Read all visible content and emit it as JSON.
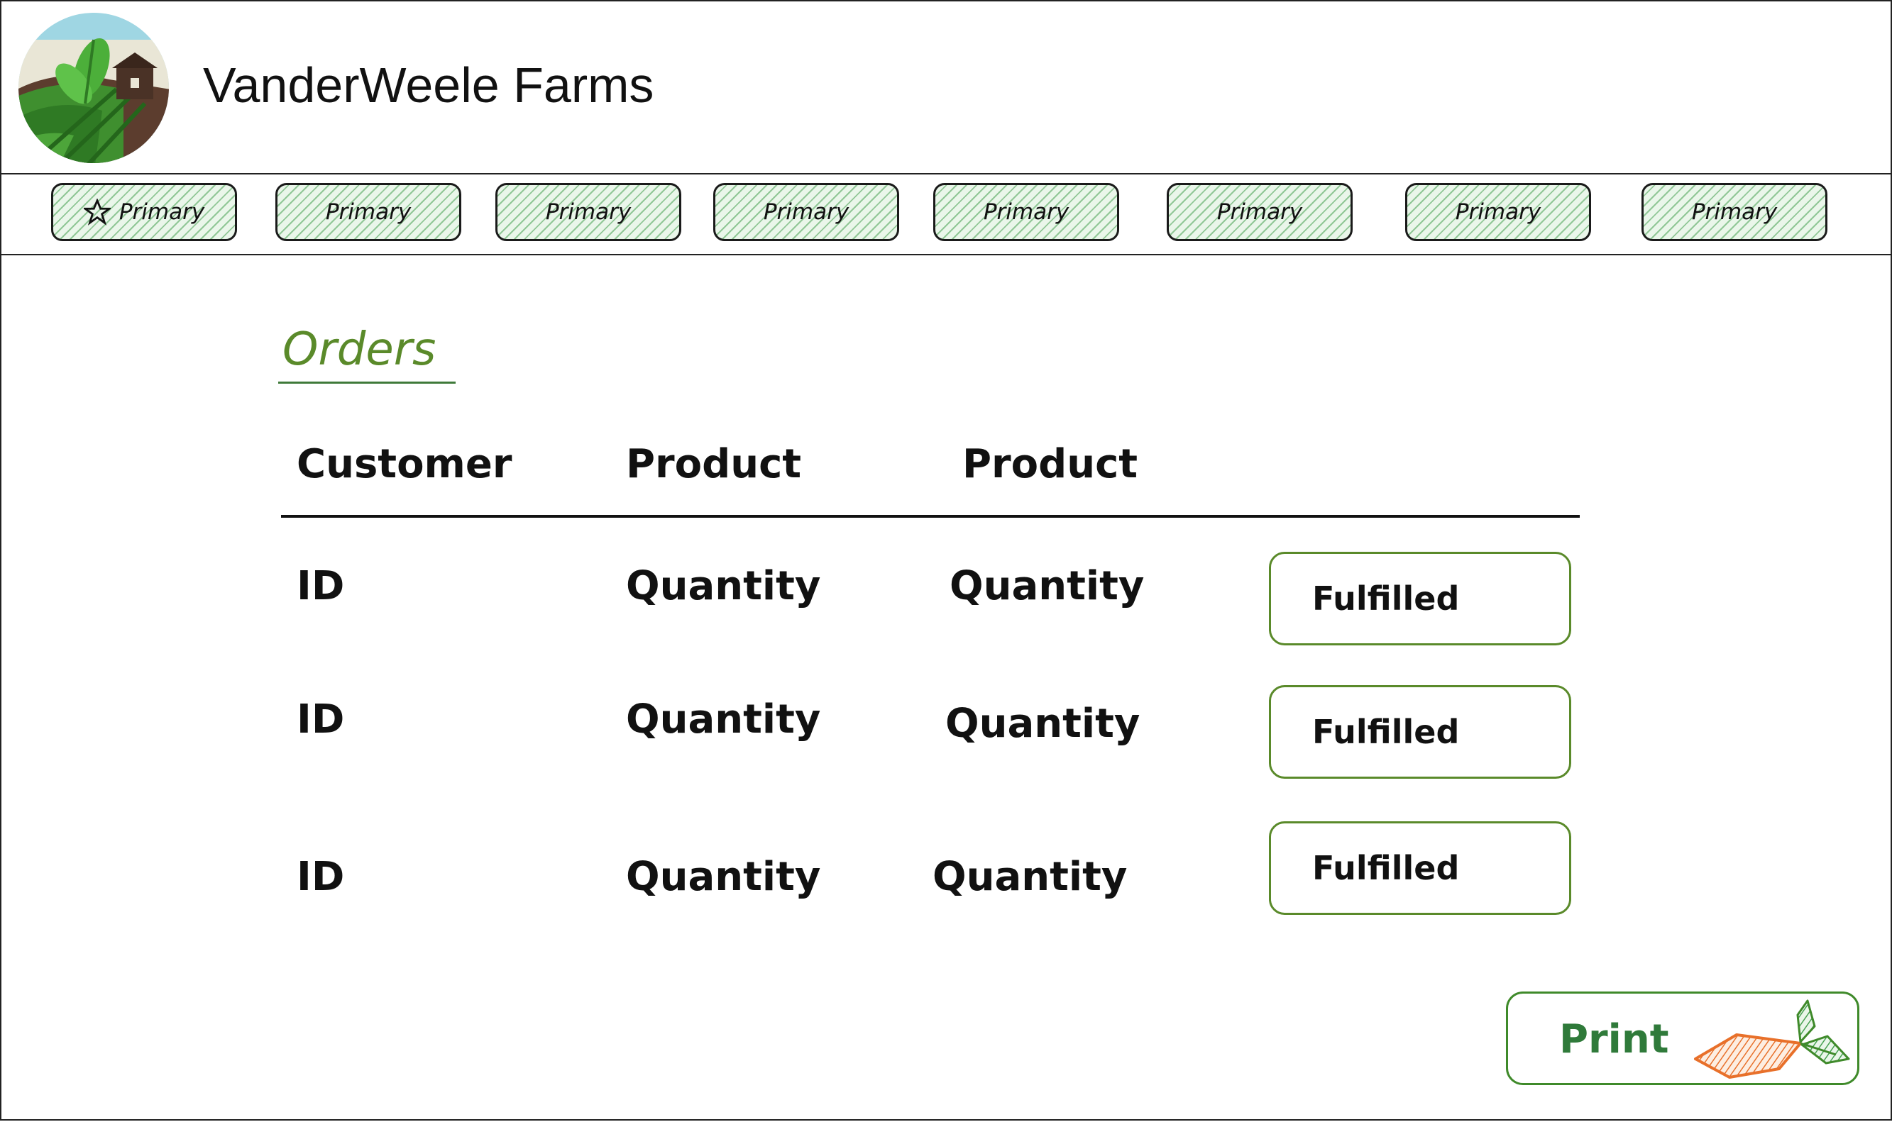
{
  "app": {
    "title": "VanderWeele Farms",
    "logo_icon": "farm-field-icon"
  },
  "nav": {
    "items": [
      {
        "label": "Primary",
        "icon": "star-icon"
      },
      {
        "label": "Primary"
      },
      {
        "label": "Primary"
      },
      {
        "label": "Primary"
      },
      {
        "label": "Primary"
      },
      {
        "label": "Primary"
      },
      {
        "label": "Primary"
      },
      {
        "label": "Primary"
      }
    ]
  },
  "orders": {
    "title": "Orders",
    "columns": [
      "Customer",
      "Product",
      "Product"
    ],
    "rows": [
      {
        "customer": "ID",
        "product_a": "Quantity",
        "product_b": "Quantity",
        "status": "Fulfilled"
      },
      {
        "customer": "ID",
        "product_a": "Quantity",
        "product_b": "Quantity",
        "status": "Fulfilled"
      },
      {
        "customer": "ID",
        "product_a": "Quantity",
        "product_b": "Quantity",
        "status": "Fulfilled"
      }
    ]
  },
  "actions": {
    "print_label": "Print",
    "print_icon": "carrot-icon"
  },
  "colors": {
    "accent_green": "#5a8a2a",
    "nav_hatch": "#46a050",
    "carrot_orange": "#e8702a"
  }
}
